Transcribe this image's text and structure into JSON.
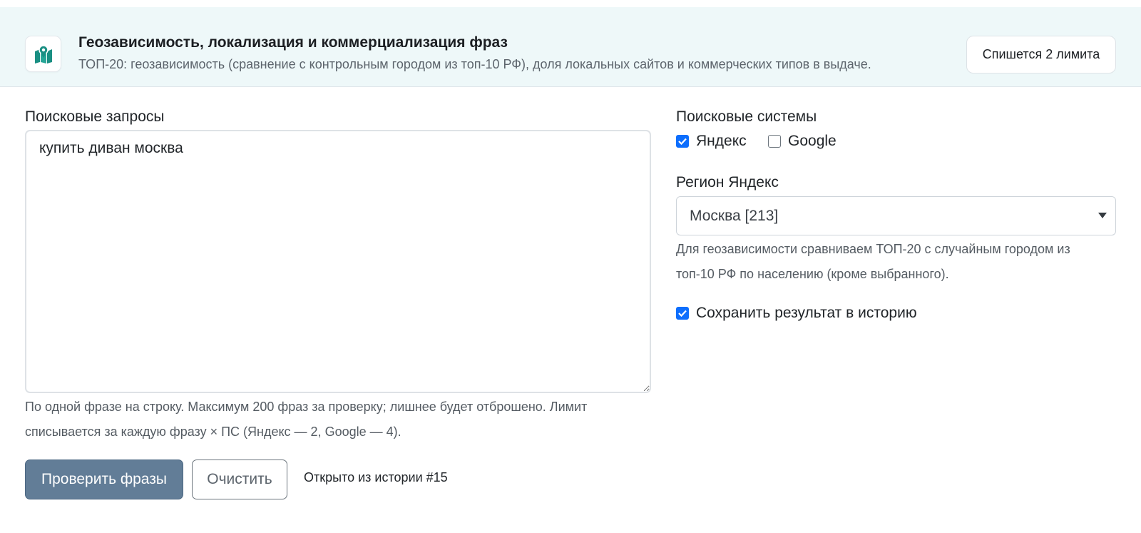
{
  "header": {
    "icon": "map-location-icon",
    "title": "Геозависимость, локализация и коммерциализация фраз",
    "subtitle": "ТОП-20: геозависимость (сравнение с контрольным городом из топ-10 РФ), доля локальных сайтов и коммерческих типов в выдаче.",
    "limit_button": "Спишется 2 лимита",
    "accent_color": "#1a8f83"
  },
  "queries": {
    "label": "Поисковые запросы",
    "value": "купить диван москва",
    "help_line1": "По одной фразе на строку. Максимум 200 фраз за проверку; лишнее будет отброшено. Лимит",
    "help_line2": "списывается за каждую фразу × ПС (Яндекс — 2, Google — 4)."
  },
  "actions": {
    "submit_label": "Проверить фразы",
    "clear_label": "Очистить",
    "history_note": "Открыто из истории #15",
    "submit_color": "#627d97"
  },
  "search_engines": {
    "label": "Поисковые системы",
    "options": [
      {
        "label": "Яндекс",
        "checked": true
      },
      {
        "label": "Google",
        "checked": false
      }
    ]
  },
  "region": {
    "label": "Регион Яндекс",
    "selected": "Москва [213]",
    "help_line1": "Для геозависимости сравниваем ТОП-20 с случайным городом из",
    "help_line2": "топ-10 РФ по населению (кроме выбранного)."
  },
  "save_history": {
    "label": "Сохранить результат в историю",
    "checked": true
  }
}
